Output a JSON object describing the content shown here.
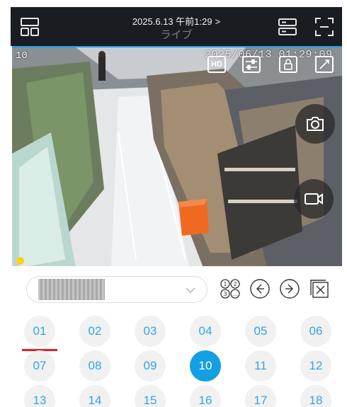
{
  "header": {
    "title": "2025.6.13 午前1:29",
    "chevron": ">",
    "subtitle": "ライブ",
    "left_icon": "multi-view-layout-icon",
    "right_icons": [
      "device-list-icon",
      "fullscreen-icon"
    ]
  },
  "video": {
    "channel_number": "10",
    "timestamp": "2025/06/13 01:29:09",
    "buttons": [
      {
        "name": "hd-quality-button",
        "label": "HD"
      },
      {
        "name": "adjust-settings-button",
        "label": ""
      },
      {
        "name": "lock-button",
        "label": ""
      },
      {
        "name": "expand-button",
        "label": ""
      }
    ],
    "side_buttons": [
      "snapshot-camera-icon",
      "record-video-icon"
    ],
    "indicator_color": "#f7d21b"
  },
  "controls": {
    "device_select": {
      "value": "",
      "icon": "chevron-down-icon"
    },
    "icons": [
      "channel-numbers-icon",
      "previous-arrow-icon",
      "next-arrow-icon",
      "close-all-icon"
    ]
  },
  "channels": {
    "items": [
      "01",
      "02",
      "03",
      "04",
      "05",
      "06",
      "07",
      "08",
      "09",
      "10",
      "11",
      "12",
      "13",
      "14",
      "15",
      "16",
      "17",
      "18"
    ],
    "active": "10",
    "underlined": "01",
    "accent_color": "#139fe3",
    "text_color": "#2fa6e8",
    "underline_color": "#e02121"
  }
}
